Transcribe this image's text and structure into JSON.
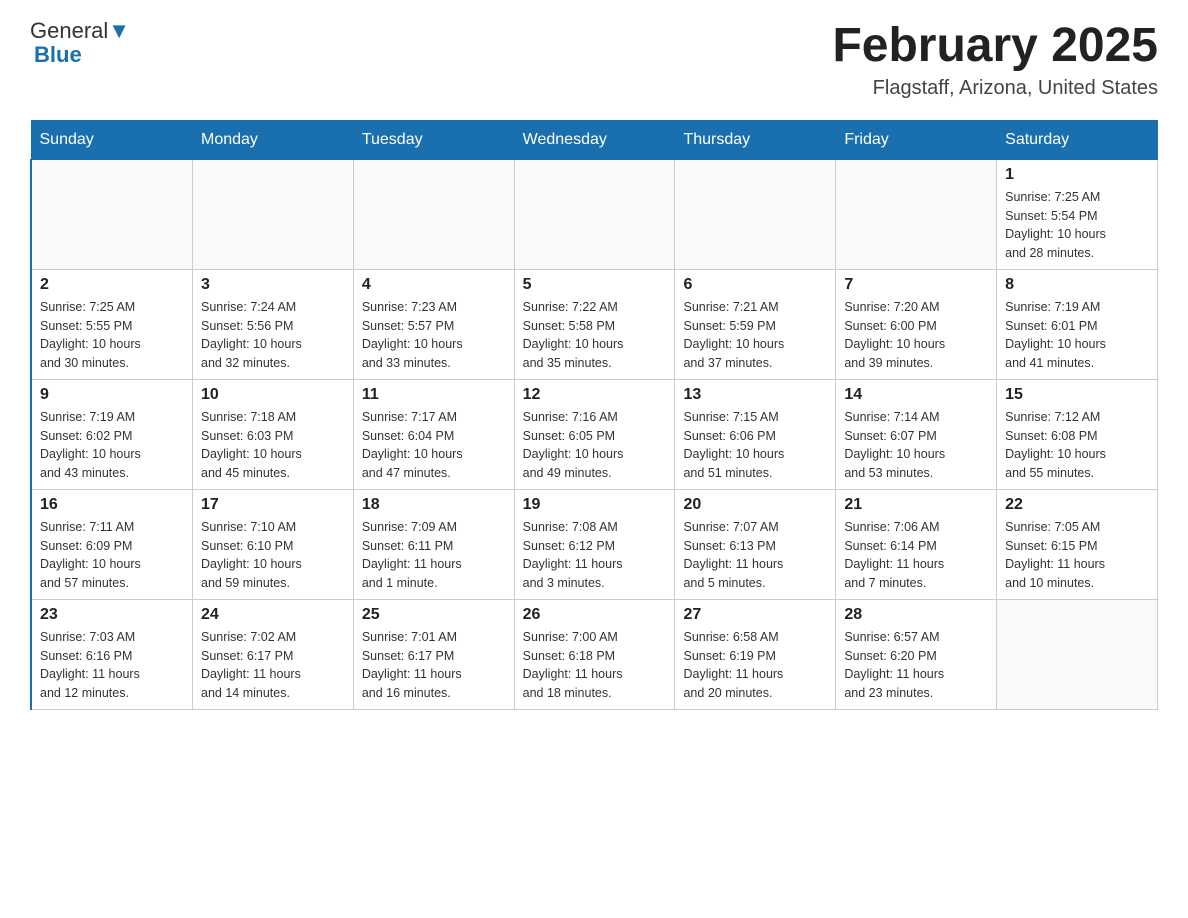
{
  "header": {
    "logo_general": "General",
    "logo_blue": "Blue",
    "month_year": "February 2025",
    "location": "Flagstaff, Arizona, United States"
  },
  "days_of_week": [
    "Sunday",
    "Monday",
    "Tuesday",
    "Wednesday",
    "Thursday",
    "Friday",
    "Saturday"
  ],
  "weeks": [
    [
      {
        "day": "",
        "info": ""
      },
      {
        "day": "",
        "info": ""
      },
      {
        "day": "",
        "info": ""
      },
      {
        "day": "",
        "info": ""
      },
      {
        "day": "",
        "info": ""
      },
      {
        "day": "",
        "info": ""
      },
      {
        "day": "1",
        "info": "Sunrise: 7:25 AM\nSunset: 5:54 PM\nDaylight: 10 hours\nand 28 minutes."
      }
    ],
    [
      {
        "day": "2",
        "info": "Sunrise: 7:25 AM\nSunset: 5:55 PM\nDaylight: 10 hours\nand 30 minutes."
      },
      {
        "day": "3",
        "info": "Sunrise: 7:24 AM\nSunset: 5:56 PM\nDaylight: 10 hours\nand 32 minutes."
      },
      {
        "day": "4",
        "info": "Sunrise: 7:23 AM\nSunset: 5:57 PM\nDaylight: 10 hours\nand 33 minutes."
      },
      {
        "day": "5",
        "info": "Sunrise: 7:22 AM\nSunset: 5:58 PM\nDaylight: 10 hours\nand 35 minutes."
      },
      {
        "day": "6",
        "info": "Sunrise: 7:21 AM\nSunset: 5:59 PM\nDaylight: 10 hours\nand 37 minutes."
      },
      {
        "day": "7",
        "info": "Sunrise: 7:20 AM\nSunset: 6:00 PM\nDaylight: 10 hours\nand 39 minutes."
      },
      {
        "day": "8",
        "info": "Sunrise: 7:19 AM\nSunset: 6:01 PM\nDaylight: 10 hours\nand 41 minutes."
      }
    ],
    [
      {
        "day": "9",
        "info": "Sunrise: 7:19 AM\nSunset: 6:02 PM\nDaylight: 10 hours\nand 43 minutes."
      },
      {
        "day": "10",
        "info": "Sunrise: 7:18 AM\nSunset: 6:03 PM\nDaylight: 10 hours\nand 45 minutes."
      },
      {
        "day": "11",
        "info": "Sunrise: 7:17 AM\nSunset: 6:04 PM\nDaylight: 10 hours\nand 47 minutes."
      },
      {
        "day": "12",
        "info": "Sunrise: 7:16 AM\nSunset: 6:05 PM\nDaylight: 10 hours\nand 49 minutes."
      },
      {
        "day": "13",
        "info": "Sunrise: 7:15 AM\nSunset: 6:06 PM\nDaylight: 10 hours\nand 51 minutes."
      },
      {
        "day": "14",
        "info": "Sunrise: 7:14 AM\nSunset: 6:07 PM\nDaylight: 10 hours\nand 53 minutes."
      },
      {
        "day": "15",
        "info": "Sunrise: 7:12 AM\nSunset: 6:08 PM\nDaylight: 10 hours\nand 55 minutes."
      }
    ],
    [
      {
        "day": "16",
        "info": "Sunrise: 7:11 AM\nSunset: 6:09 PM\nDaylight: 10 hours\nand 57 minutes."
      },
      {
        "day": "17",
        "info": "Sunrise: 7:10 AM\nSunset: 6:10 PM\nDaylight: 10 hours\nand 59 minutes."
      },
      {
        "day": "18",
        "info": "Sunrise: 7:09 AM\nSunset: 6:11 PM\nDaylight: 11 hours\nand 1 minute."
      },
      {
        "day": "19",
        "info": "Sunrise: 7:08 AM\nSunset: 6:12 PM\nDaylight: 11 hours\nand 3 minutes."
      },
      {
        "day": "20",
        "info": "Sunrise: 7:07 AM\nSunset: 6:13 PM\nDaylight: 11 hours\nand 5 minutes."
      },
      {
        "day": "21",
        "info": "Sunrise: 7:06 AM\nSunset: 6:14 PM\nDaylight: 11 hours\nand 7 minutes."
      },
      {
        "day": "22",
        "info": "Sunrise: 7:05 AM\nSunset: 6:15 PM\nDaylight: 11 hours\nand 10 minutes."
      }
    ],
    [
      {
        "day": "23",
        "info": "Sunrise: 7:03 AM\nSunset: 6:16 PM\nDaylight: 11 hours\nand 12 minutes."
      },
      {
        "day": "24",
        "info": "Sunrise: 7:02 AM\nSunset: 6:17 PM\nDaylight: 11 hours\nand 14 minutes."
      },
      {
        "day": "25",
        "info": "Sunrise: 7:01 AM\nSunset: 6:17 PM\nDaylight: 11 hours\nand 16 minutes."
      },
      {
        "day": "26",
        "info": "Sunrise: 7:00 AM\nSunset: 6:18 PM\nDaylight: 11 hours\nand 18 minutes."
      },
      {
        "day": "27",
        "info": "Sunrise: 6:58 AM\nSunset: 6:19 PM\nDaylight: 11 hours\nand 20 minutes."
      },
      {
        "day": "28",
        "info": "Sunrise: 6:57 AM\nSunset: 6:20 PM\nDaylight: 11 hours\nand 23 minutes."
      },
      {
        "day": "",
        "info": ""
      }
    ]
  ]
}
